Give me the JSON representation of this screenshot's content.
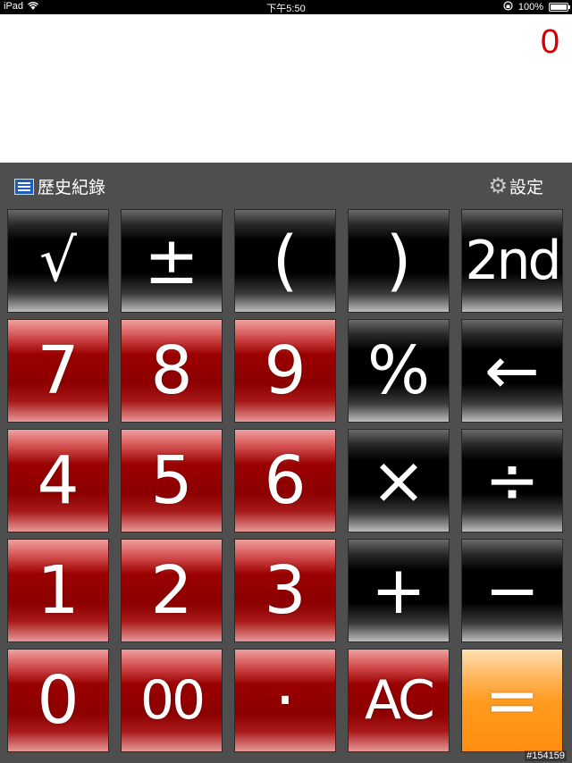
{
  "status_bar": {
    "device": "iPad",
    "time": "下午5:50",
    "battery": "100%",
    "battery_level": 1.0
  },
  "display": {
    "value": "0",
    "color": "#d40000"
  },
  "toolbar": {
    "history_label": "歷史紀錄",
    "settings_label": "設定"
  },
  "keys": {
    "sqrt": "√",
    "plus_minus": "±",
    "open_paren": "(",
    "close_paren": ")",
    "second": "2nd",
    "seven": "7",
    "eight": "8",
    "nine": "9",
    "percent": "%",
    "backspace": "←",
    "four": "4",
    "five": "5",
    "six": "6",
    "multiply": "×",
    "divide": "÷",
    "one": "1",
    "two": "2",
    "three": "3",
    "plus": "+",
    "minus": "−",
    "zero": "0",
    "double_zero": "00",
    "decimal": "·",
    "clear": "AC",
    "equals": "="
  },
  "watermark": "#154159",
  "colors": {
    "digit_key": "#8c0000",
    "operator_key": "#000000",
    "equals_key": "#ff9a1e"
  }
}
